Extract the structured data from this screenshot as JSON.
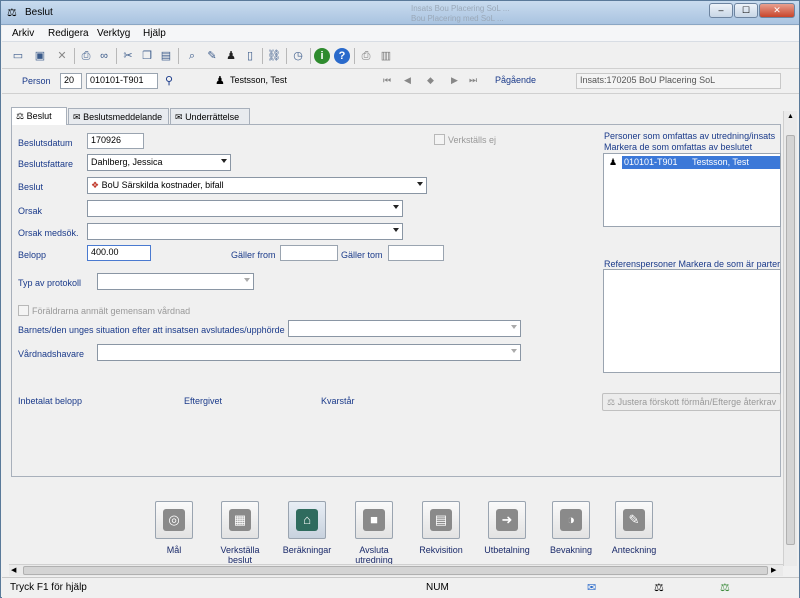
{
  "window": {
    "title": "Beslut",
    "ghost_texts": [
      "Insats Bou Placering SoL ...",
      "Bou Placering med SoL ..."
    ],
    "controls": {
      "min": "–",
      "max": "☐",
      "close": "✕"
    }
  },
  "menu": [
    "Arkiv",
    "Redigera",
    "Verktyg",
    "Hjälp"
  ],
  "toolbar_icons": [
    "new-icon",
    "save-icon",
    "delete-icon",
    "print-icon",
    "binoculars-icon",
    "cut-icon",
    "copy-icon",
    "paste-icon",
    "preview-icon",
    "pin-icon",
    "person-icon",
    "document-icon",
    "link-icon",
    "timer-icon",
    "info-icon",
    "help-icon",
    "printer-icon",
    "chart-icon"
  ],
  "person_bar": {
    "label": "Person",
    "number": "20",
    "id": "010101-T901",
    "name": "Testsson, Test",
    "status": "Pågående",
    "insats": "Insats:170205 BoU Placering SoL"
  },
  "tabs": [
    "Beslut",
    "Beslutsmeddelande",
    "Underrättelse"
  ],
  "form": {
    "beslutsdatum_label": "Beslutsdatum",
    "beslutsdatum": "170926",
    "verkstalls_ej": "Verkställs ej",
    "beslutsfattare_label": "Beslutsfattare",
    "beslutsfattare": "Dahlberg, Jessica",
    "beslut_label": "Beslut",
    "beslut": "BoU Särskilda kostnader, bifall",
    "orsak_label": "Orsak",
    "orsak_medsok_label": "Orsak medsök.",
    "belopp_label": "Belopp",
    "belopp": "400.00",
    "galler_from_label": "Gäller from",
    "galler_tom_label": "Gäller tom",
    "typ_protokoll_label": "Typ av protokoll",
    "foraldrarna_label": "Föräldrarna anmält gemensam vårdnad",
    "barnets_label": "Barnets/den unges situation efter att insatsen avslutades/upphörde",
    "vardnadshavare_label": "Vårdnadshavare",
    "inbetalat_label": "Inbetalat belopp",
    "eftergivet_label": "Eftergivet",
    "kvarstar_label": "Kvarstår"
  },
  "right_panel": {
    "personer_title": "Personer som omfattas av utredning/insats",
    "personer_sub": "Markera de som omfattas av beslutet",
    "person_id": "010101-T901",
    "person_name": "Testsson, Test",
    "referens_title": "Referenspersoner Markera de som är parter",
    "justera_button": "Justera förskott förmån/Efterge återkrav"
  },
  "big_buttons": [
    {
      "label": "Mål",
      "icon": "target-icon"
    },
    {
      "label": "Verkställa beslut",
      "icon": "execute-icon"
    },
    {
      "label": "Beräkningar",
      "icon": "calculation-icon"
    },
    {
      "label": "Avsluta utredning",
      "icon": "stop-icon"
    },
    {
      "label": "Rekvisition",
      "icon": "requisition-icon"
    },
    {
      "label": "Utbetalning",
      "icon": "payment-icon"
    },
    {
      "label": "Bevakning",
      "icon": "watch-icon"
    },
    {
      "label": "Anteckning",
      "icon": "note-icon"
    }
  ],
  "status_bar": {
    "help": "Tryck F1 för hjälp",
    "num": "NUM"
  }
}
